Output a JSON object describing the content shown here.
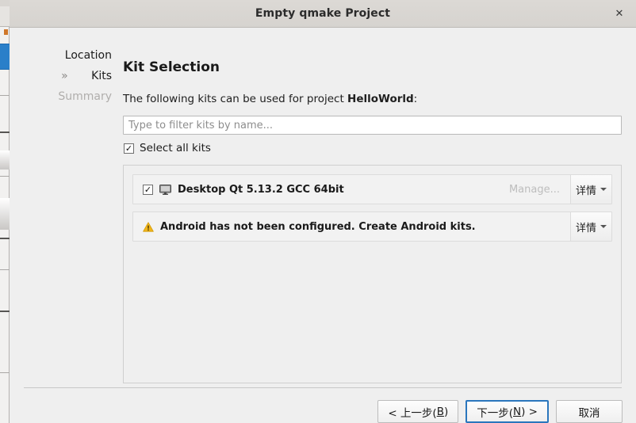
{
  "window": {
    "title": "Empty qmake Project",
    "close_label": "✕"
  },
  "sidebar": {
    "items": [
      {
        "label": "Location",
        "state": "done",
        "arrow": ""
      },
      {
        "label": "Kits",
        "state": "current",
        "arrow": "»"
      },
      {
        "label": "Summary",
        "state": "disabled",
        "arrow": ""
      }
    ]
  },
  "content": {
    "page_title": "Kit Selection",
    "intro_prefix": "The following kits can be used for project ",
    "intro_project": "HelloWorld",
    "intro_suffix": ":",
    "filter": {
      "placeholder": "Type to filter kits by name...",
      "value": ""
    },
    "select_all": {
      "label": "Select all kits",
      "checked": true,
      "check_glyph": "✓"
    },
    "kits": [
      {
        "icon": "desktop-monitor-icon",
        "label": "Desktop Qt 5.13.2 GCC 64bit",
        "checked": true,
        "check_glyph": "✓",
        "manage_label": "Manage...",
        "details_label": "详情"
      },
      {
        "icon": "warning-triangle-icon",
        "label": "Android has not been configured. Create Android kits.",
        "checked": false,
        "check_glyph": "",
        "manage_label": "",
        "details_label": "详情"
      }
    ]
  },
  "footer": {
    "back_button": {
      "pre": "< 上一步(",
      "mnemonic": "B",
      "post": ")"
    },
    "next_button": {
      "pre": "下一步(",
      "mnemonic": "N",
      "post": ") >"
    },
    "cancel_button": {
      "label": "取消"
    }
  },
  "colors": {
    "dialog_bg": "#efefef",
    "titlebar_bg": "#d8d5d1",
    "accent_blue": "#2a76bd",
    "warning_amber": "#f0b419",
    "disabled_text": "#b0aeac"
  }
}
